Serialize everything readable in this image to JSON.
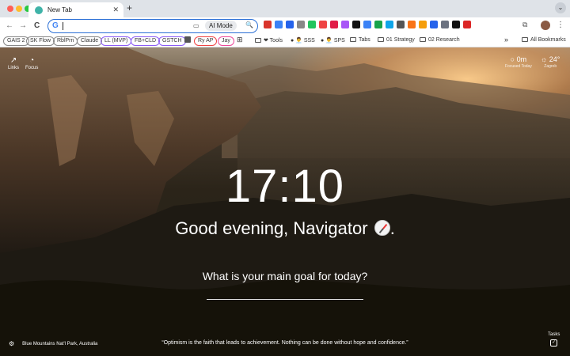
{
  "browser": {
    "tab": {
      "title": "New Tab",
      "close": "✕"
    },
    "new_tab": "+",
    "tab_search": "⌄",
    "nav": {
      "back": "←",
      "forward": "→",
      "reload": "C"
    },
    "omnibox": {
      "value": "",
      "ai_mode": "AI Mode",
      "logo": "G"
    },
    "extensions": [
      "#d9342b",
      "#3b82f6",
      "#2563eb",
      "#888888",
      "#22c55e",
      "#ef4444",
      "#e11d48",
      "#a855f7",
      "#111111",
      "#3b82f6",
      "#16a34a",
      "#0ea5e9",
      "#555555",
      "#f97316",
      "#f59e0b",
      "#2563eb",
      "#6b7280",
      "#111111",
      "#dc2626"
    ],
    "bookmarks": {
      "chips": [
        {
          "label": "GAIS 2",
          "color": "#888888"
        },
        {
          "label": "SK Flow",
          "color": "#888888"
        },
        {
          "label": "RblPrn",
          "color": "#888888"
        },
        {
          "label": "Claude",
          "color": "#888888"
        },
        {
          "label": "LL (MVP)",
          "color": "#8b5cf6"
        },
        {
          "label": "FB+CLD",
          "color": "#8b5cf6"
        },
        {
          "label": "GSTCH",
          "color": "#8b5cf6"
        },
        {
          "label": "Ry AP",
          "color": "#ef4444"
        },
        {
          "label": "Jay",
          "color": "#ec4899"
        }
      ],
      "items": [
        {
          "label": "❤ Tools",
          "folder": true
        },
        {
          "label": "👨‍💼 SSS",
          "folder": false
        },
        {
          "label": "👨‍💼 SPS",
          "folder": false
        },
        {
          "label": "Tabs",
          "folder": true
        },
        {
          "label": "01 Strategy",
          "folder": true
        },
        {
          "label": "02 Research",
          "folder": true
        }
      ],
      "more": "»",
      "all_bookmarks": "All Bookmarks"
    }
  },
  "page": {
    "links_label": "Links",
    "focus_label": "Focus",
    "weather": [
      {
        "value": "0m",
        "sub": "Focused Today",
        "icon": "○"
      },
      {
        "value": "24°",
        "sub": "Zagreb",
        "icon": "☼"
      }
    ],
    "clock": "17:10",
    "greeting": "Good evening, Navigator",
    "question": "What is your main goal for today?",
    "goal_value": "",
    "photo_credit": "Blue Mountains Nat'l Park, Australia",
    "quote": "“Optimism is the faith that leads to achievement. Nothing can be done without hope and confidence.”",
    "tasks_label": "Tasks",
    "tasks_check": "✓"
  }
}
